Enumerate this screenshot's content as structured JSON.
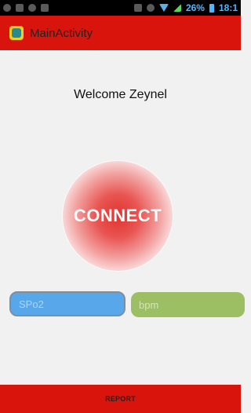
{
  "status_bar": {
    "battery_percent": "26%",
    "time": "18:1",
    "icons": [
      "notification-icon",
      "gallery-icon",
      "whatsapp-icon",
      "chat-icon",
      "vibrate-icon",
      "alarm-icon",
      "wifi-icon",
      "signal-icon",
      "battery-icon"
    ]
  },
  "action_bar": {
    "title": "MainActivity",
    "color": "#d8140d"
  },
  "main": {
    "welcome": "Welcome Zeynel",
    "connect_label": "CONNECT",
    "spo2_placeholder": "SPo2",
    "bpm_placeholder": "bpm"
  },
  "bottom_bar": {
    "report_label": "REPORT",
    "color": "#d8140d"
  }
}
